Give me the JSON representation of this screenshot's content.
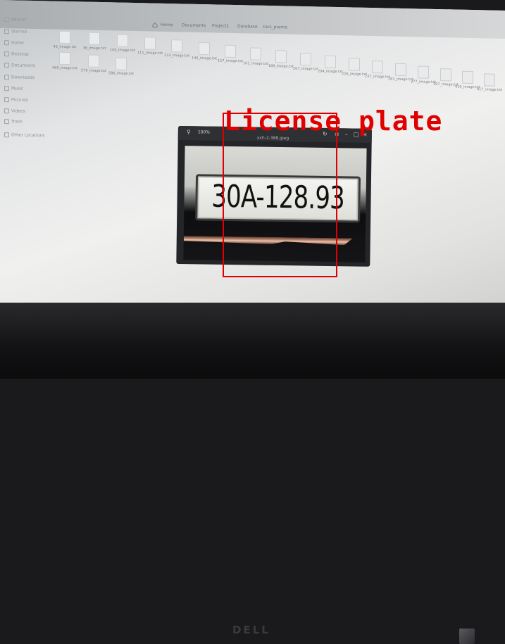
{
  "file_manager": {
    "breadcrumbs": [
      "Home",
      "Documents",
      "Project1",
      "Database",
      "cars_promo"
    ],
    "sidebar": [
      "Recent",
      "Starred",
      "Home",
      "Desktop",
      "Documents",
      "Downloads",
      "Music",
      "Pictures",
      "Videos",
      "Trash",
      "Other Locations"
    ],
    "files_row1": [
      "43_image.txt",
      "36_image.txt",
      "100_image.txt",
      "111_image.txt",
      "133_image.txt",
      "140_image.txt",
      "157_image.txt",
      "161_image.txt",
      "189_image.txt",
      "207_image.txt",
      "204_image.txt",
      "226_image.txt",
      "237_image.txt",
      "281_image.txt",
      "377_image.txt",
      "397_image.txt",
      "410_image.txt",
      "417_image.txt"
    ],
    "files_row2": [
      "469_image.txt",
      "570_image.txt",
      "586_image.txt"
    ]
  },
  "viewer": {
    "zoom": "100%",
    "title": "xxh-2-388.jpeg"
  },
  "plate": {
    "text": "30A-128.93"
  },
  "detection": {
    "label": "License plate",
    "color": "#e00000"
  },
  "monitor": {
    "brand": "DELL"
  }
}
